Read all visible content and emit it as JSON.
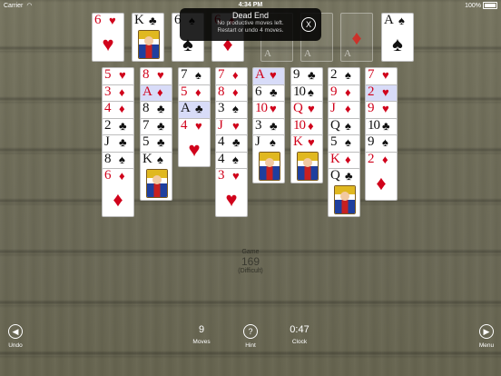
{
  "status": {
    "carrier": "Carrier",
    "time": "4:34 PM",
    "battery": "100%"
  },
  "toast": {
    "title": "Dead End",
    "line1": "No productive moves left.",
    "line2": "Restart or undo 4 moves.",
    "close": "X"
  },
  "free_cells": [
    {
      "rank": "6",
      "suit": "♥",
      "color": "red"
    },
    {
      "rank": "K",
      "suit": "♣",
      "color": "black"
    },
    {
      "rank": "6",
      "suit": "♠",
      "color": "black"
    },
    {
      "rank": "6",
      "suit": "♦",
      "color": "red"
    }
  ],
  "foundations": [
    {
      "ghost": "A",
      "suit": ""
    },
    {
      "ghost": "A",
      "suit": ""
    },
    {
      "ghost": "A",
      "suit": "♦"
    },
    {
      "rank": "A",
      "suit": "♠",
      "color": "black"
    }
  ],
  "tableau": [
    [
      {
        "r": "5",
        "s": "♥"
      },
      {
        "r": "3",
        "s": "♦"
      },
      {
        "r": "4",
        "s": "♦"
      },
      {
        "r": "2",
        "s": "♣"
      },
      {
        "r": "J",
        "s": "♣"
      },
      {
        "r": "8",
        "s": "♠"
      },
      {
        "r": "6",
        "s": "♦"
      }
    ],
    [
      {
        "r": "8",
        "s": "♥"
      },
      {
        "r": "A",
        "s": "♦",
        "sel": true
      },
      {
        "r": "8",
        "s": "♣"
      },
      {
        "r": "7",
        "s": "♣"
      },
      {
        "r": "5",
        "s": "♣"
      },
      {
        "r": "K",
        "s": "♠"
      }
    ],
    [
      {
        "r": "7",
        "s": "♠"
      },
      {
        "r": "5",
        "s": "♦"
      },
      {
        "r": "A",
        "s": "♣",
        "sel": true
      },
      {
        "r": "4",
        "s": "♥"
      }
    ],
    [
      {
        "r": "7",
        "s": "♦"
      },
      {
        "r": "8",
        "s": "♦"
      },
      {
        "r": "3",
        "s": "♠"
      },
      {
        "r": "J",
        "s": "♥"
      },
      {
        "r": "4",
        "s": "♣"
      },
      {
        "r": "4",
        "s": "♠"
      },
      {
        "r": "3",
        "s": "♥"
      }
    ],
    [
      {
        "r": "A",
        "s": "♥",
        "sel": true
      },
      {
        "r": "6",
        "s": "♣"
      },
      {
        "r": "10",
        "s": "♥"
      },
      {
        "r": "3",
        "s": "♣"
      },
      {
        "r": "J",
        "s": "♠"
      }
    ],
    [
      {
        "r": "9",
        "s": "♣"
      },
      {
        "r": "10",
        "s": "♠"
      },
      {
        "r": "Q",
        "s": "♥"
      },
      {
        "r": "10",
        "s": "♦"
      },
      {
        "r": "K",
        "s": "♥"
      }
    ],
    [
      {
        "r": "2",
        "s": "♠"
      },
      {
        "r": "9",
        "s": "♦"
      },
      {
        "r": "J",
        "s": "♦"
      },
      {
        "r": "Q",
        "s": "♠"
      },
      {
        "r": "5",
        "s": "♠"
      },
      {
        "r": "K",
        "s": "♦"
      },
      {
        "r": "Q",
        "s": "♣"
      }
    ],
    [
      {
        "r": "7",
        "s": "♥"
      },
      {
        "r": "2",
        "s": "♥",
        "sel": true
      },
      {
        "r": "9",
        "s": "♥"
      },
      {
        "r": "10",
        "s": "♣"
      },
      {
        "r": "9",
        "s": "♠"
      },
      {
        "r": "2",
        "s": "♦"
      }
    ]
  ],
  "game": {
    "label": "Game",
    "number": "169",
    "difficulty": "(Difficult)"
  },
  "toolbar": {
    "undo": "Undo",
    "moves_value": "9",
    "moves": "Moves",
    "hint": "Hint",
    "clock_value": "0:47",
    "clock": "Clock",
    "menu": "Menu",
    "undo_icon": "◀",
    "hint_icon": "?",
    "menu_icon": "▶"
  }
}
